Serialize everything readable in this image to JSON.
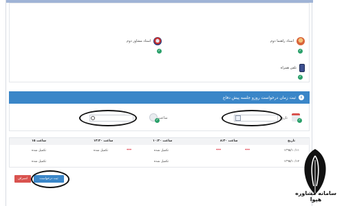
{
  "advisors": [
    {
      "label": "استاد راهنما دوم"
    },
    {
      "label": "استاد مشاور دوم"
    },
    {
      "label": "تلفن همراه"
    }
  ],
  "section": {
    "number": "۵",
    "title": "ثبت زمان درخواست روزو جلسه پیش دفاع"
  },
  "form": {
    "date_label": "تاریخ",
    "time_label": "ساعت"
  },
  "table": {
    "headers": [
      "تاریخ",
      "ساعت ۸:۳۰",
      "ساعت ۱۰:۳۰",
      "ساعت ۱۳:۳۰",
      "ساعت ۱۵"
    ],
    "rows": [
      {
        "date": "۱۳۹۵/۱۰/۱۱",
        "c1": "***",
        "c2": "***",
        "c3": "تکمیل شده",
        "c4": "***",
        "c5": "تکمیل شده",
        "c6": "تکمیل شده"
      },
      {
        "date": "۱۳۹۵/۱۰/۱۲",
        "c3": "تکمیل شده",
        "c6": "تکمیل شده"
      }
    ]
  },
  "buttons": {
    "submit": "ثبت درخواست",
    "cancel": "انصراف"
  },
  "watermark": {
    "site": "سامانه مشاوره هپوا"
  },
  "colors": {
    "header_blue": "#3a86c8",
    "submit_blue": "#3a86c8",
    "cancel_red": "#d9534f",
    "check_green": "#2aa06a"
  }
}
